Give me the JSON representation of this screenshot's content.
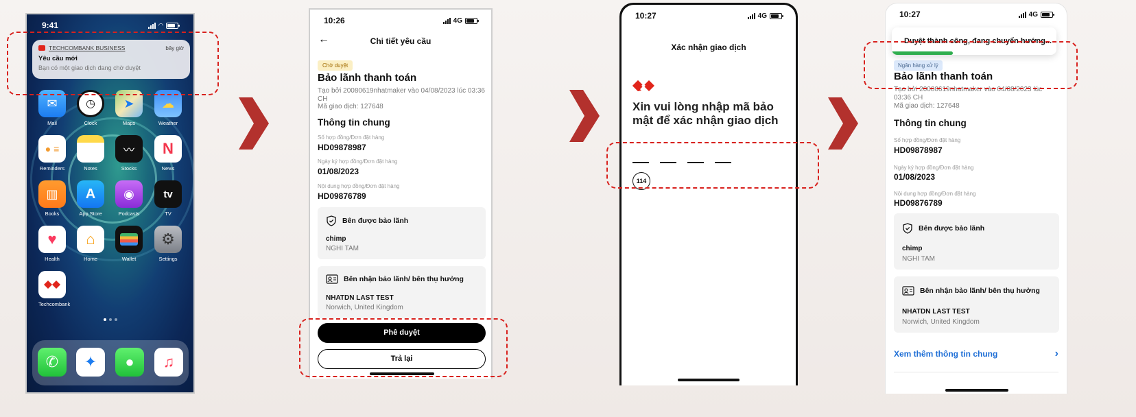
{
  "phone1": {
    "time": "9:41",
    "notification": {
      "app_name": "TECHCOMBANK BUSINESS",
      "when": "bây giờ",
      "title": "Yêu cầu mới",
      "body": "Bạn có một giao dịch đang chờ duyệt"
    },
    "apps": {
      "mail": "Mail",
      "clock": "Clock",
      "maps": "Maps",
      "weather": "Weather",
      "reminders": "Reminders",
      "notes": "Notes",
      "stocks": "Stocks",
      "news": "News",
      "books": "Books",
      "app_store": "App Store",
      "podcasts": "Podcasts",
      "tv": "TV",
      "health": "Health",
      "home": "Home",
      "wallet": "Wallet",
      "settings": "Settings",
      "techcombank": "Techcombank"
    },
    "tv_glyph": "tv"
  },
  "phone2": {
    "time": "10:26",
    "network": "4G",
    "title": "Chi tiết yêu cầu",
    "status": "Chờ duyệt",
    "heading": "Bảo lãnh thanh toán",
    "created": "Tạo bởi 20080619nhatmaker vào 04/08/2023 lúc 03:36 CH",
    "txn": "Mã giao dịch: 127648",
    "section": "Thông tin chung",
    "fields": [
      {
        "label": "Số hợp đồng/Đơn đặt hàng",
        "value": "HD09878987"
      },
      {
        "label": "Ngày ký hợp đồng/Đơn đặt hàng",
        "value": "01/08/2023"
      },
      {
        "label": "Nội dung hợp đồng/Đơn đặt hàng",
        "value": "HD09876789"
      }
    ],
    "guaranteed": {
      "title": "Bên được bảo lãnh",
      "name": "chimp",
      "sub": "NGHI TAM"
    },
    "beneficiary": {
      "title": "Bên nhận bảo lãnh/ bên thụ hưởng",
      "name": "NHATDN LAST TEST",
      "sub": "Norwich, United Kingdom"
    },
    "approve": "Phê duyệt",
    "return": "Trả lại"
  },
  "phone3": {
    "time": "10:27",
    "network": "4G",
    "title": "Xác nhận giao dịch",
    "prompt": "Xin vui lòng nhập mã bảo mật để xác nhận giao dịch",
    "countdown": "114"
  },
  "phone4": {
    "time": "10:27",
    "network": "4G",
    "toast": "Duyệt thành công, đang chuyển hướng...",
    "toast_progress": 0.37,
    "status": "Ngân hàng xử lý",
    "heading": "Bảo lãnh thanh toán",
    "created": "Tạo bởi 20080619nhatmaker vào 04/08/2023 lúc 03:36 CH",
    "txn": "Mã giao dịch: 127648",
    "section": "Thông tin chung",
    "fields": [
      {
        "label": "Số hợp đồng/Đơn đặt hàng",
        "value": "HD09878987"
      },
      {
        "label": "Ngày ký hợp đồng/Đơn đặt hàng",
        "value": "01/08/2023"
      },
      {
        "label": "Nội dung hợp đồng/Đơn đặt hàng",
        "value": "HD09876789"
      }
    ],
    "guaranteed": {
      "title": "Bên được bảo lãnh",
      "name": "chimp",
      "sub": "NGHI TAM"
    },
    "beneficiary": {
      "title": "Bên nhận bảo lãnh/ bên thụ hưởng",
      "name": "NHATDN LAST TEST",
      "sub": "Norwich, United Kingdom"
    },
    "more": "Xem thêm thông tin chung"
  },
  "colors": {
    "brand_red": "#e1251b",
    "highlight": "#d8211d",
    "arrow": "#b3312d",
    "link": "#1f6fd6",
    "success": "#2fae4e"
  }
}
